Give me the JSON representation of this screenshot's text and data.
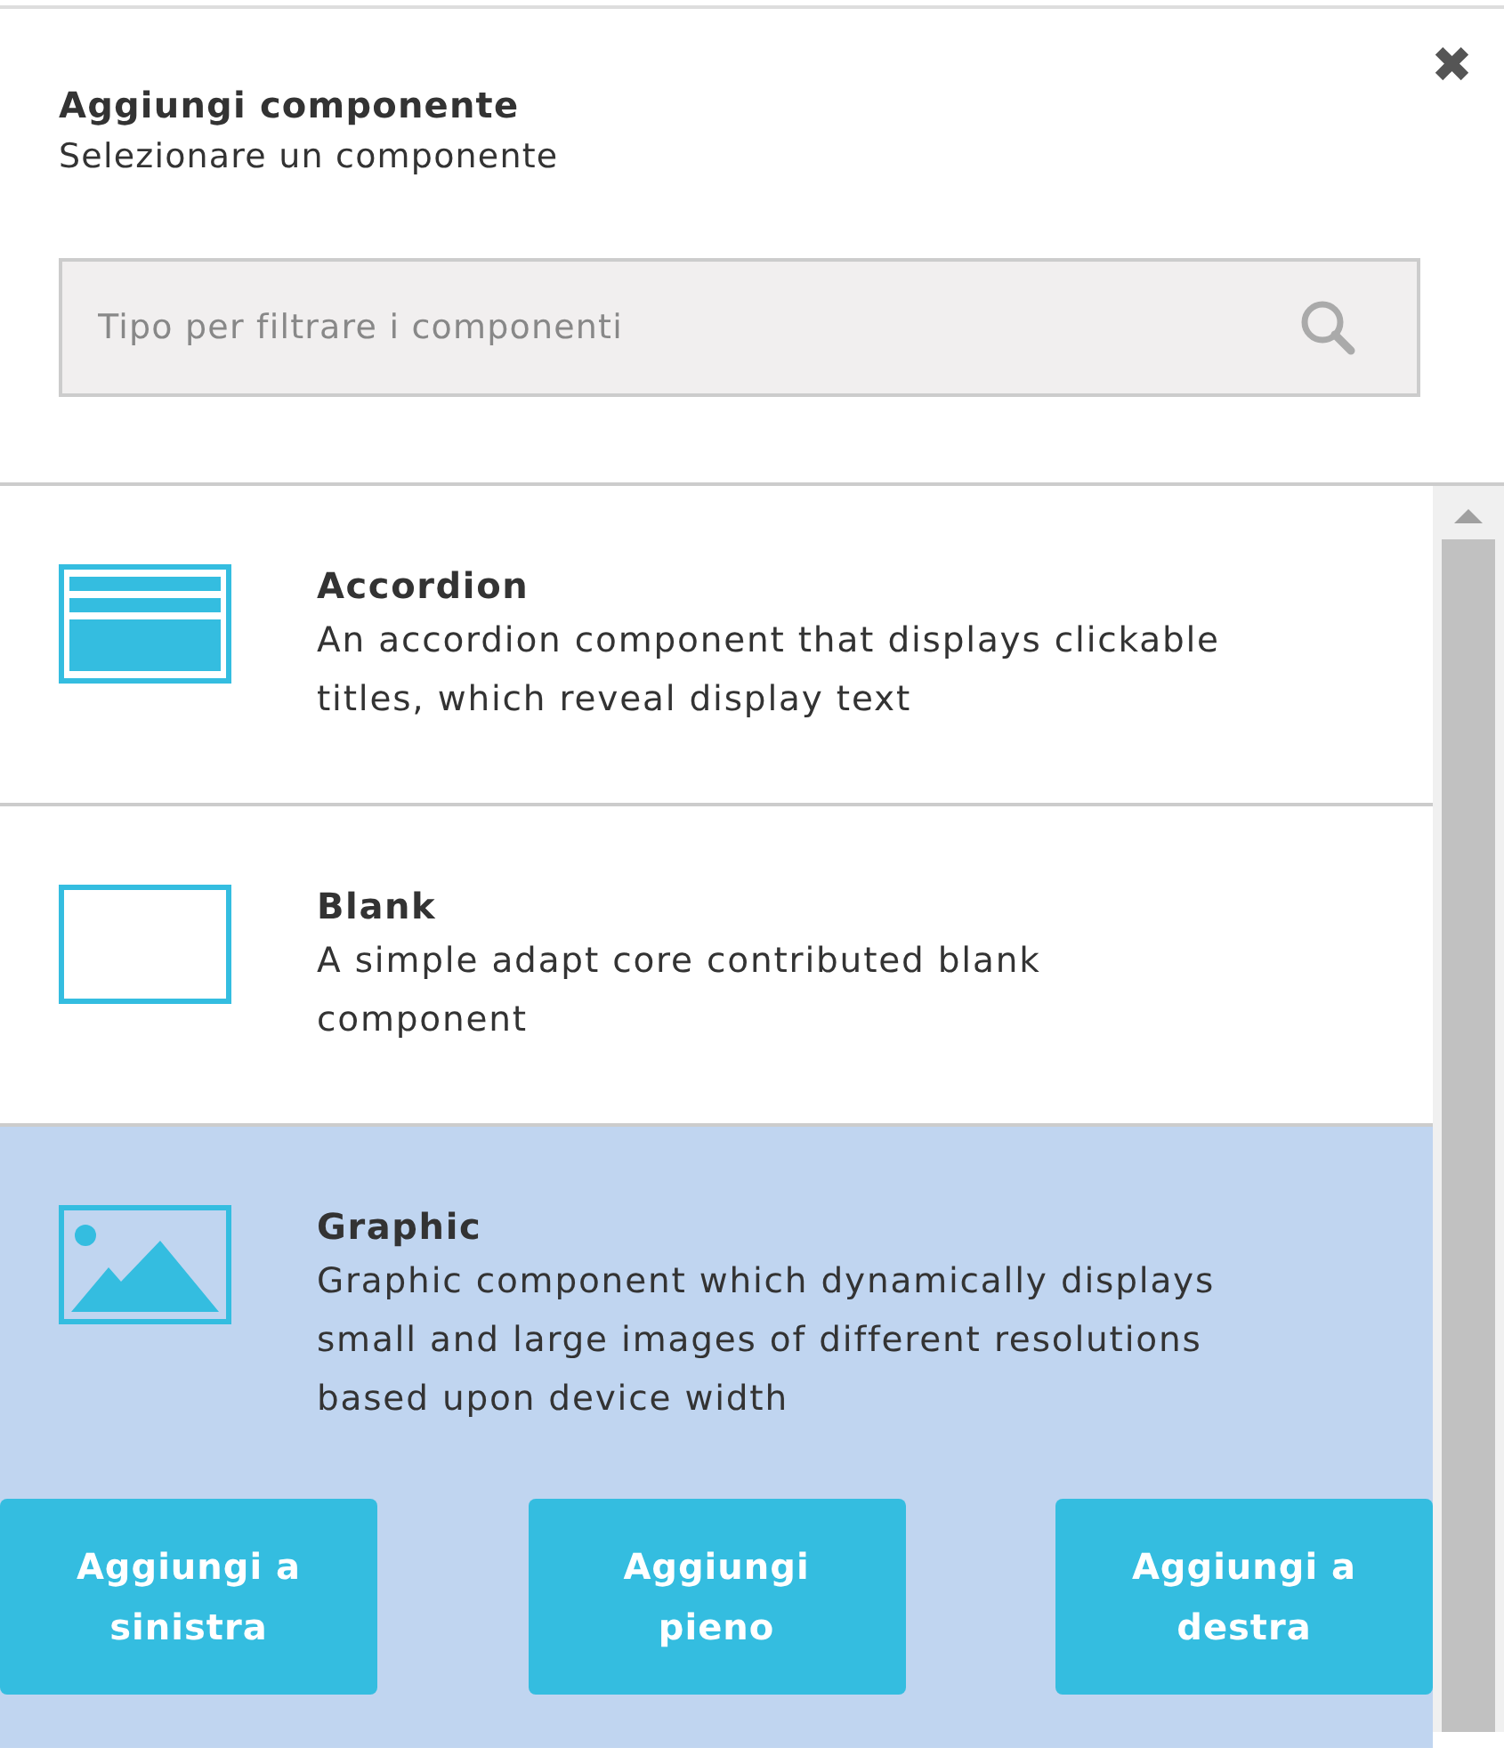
{
  "dialog": {
    "close_label": "✖",
    "title": "Aggiungi componente",
    "subtitle": "Selezionare un componente"
  },
  "search": {
    "placeholder": "Tipo per filtrare i componenti"
  },
  "components": [
    {
      "kind": "accordion",
      "name": "Accordion",
      "description": "An accordion component that displays clickable titles, which reveal display text",
      "selected": false
    },
    {
      "kind": "blank",
      "name": "Blank",
      "description": "A simple adapt core contributed blank component",
      "selected": false
    },
    {
      "kind": "graphic",
      "name": "Graphic",
      "description": "Graphic component which dynamically displays small and large images of different resolutions based upon device width",
      "selected": true,
      "actions": [
        "Aggiungi a sinistra",
        "Aggiungi pieno",
        "Aggiungi a destra"
      ]
    }
  ]
}
